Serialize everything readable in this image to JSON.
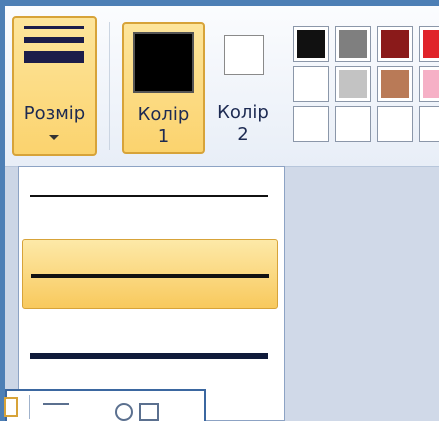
{
  "ribbon": {
    "size_button": {
      "label": "Розмір"
    },
    "color1": {
      "label_line1": "Колір",
      "label_line2": "1",
      "value": "#000000"
    },
    "color2": {
      "label_line1": "Колір",
      "label_line2": "2",
      "value": "#ffffff"
    },
    "palette": [
      "#111111",
      "#7f7f7f",
      "#8a1a1a",
      "#e0242a",
      "#ffffff",
      "#c3c3c3",
      "#b97a57",
      "#f6b0c6",
      "#ffffff",
      "#ffffff",
      "#ffffff",
      "#ffffff"
    ]
  },
  "size_dropdown": {
    "options": [
      {
        "name": "thin",
        "selected": false
      },
      {
        "name": "medium",
        "selected": true
      },
      {
        "name": "thick",
        "selected": false
      }
    ]
  },
  "accent_color": "#fbd36e"
}
